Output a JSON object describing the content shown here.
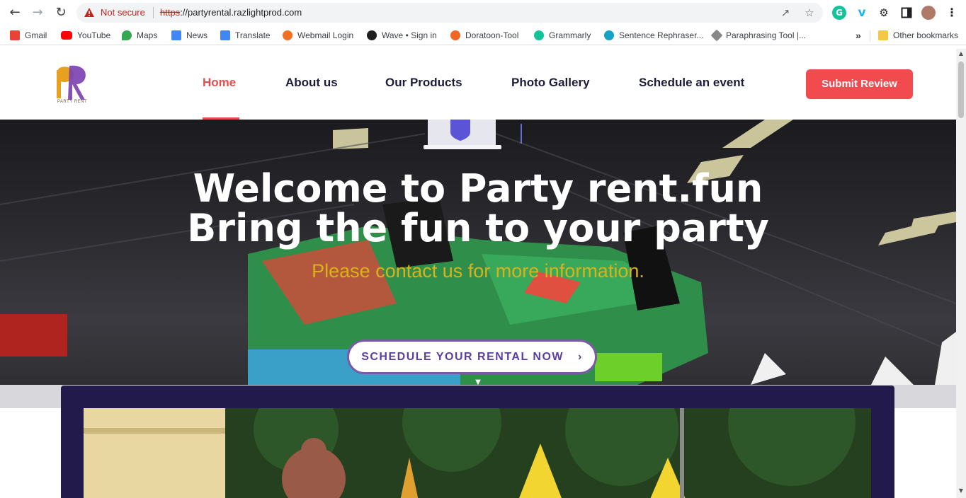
{
  "browser": {
    "not_secure_label": "Not secure",
    "url_scheme": "https",
    "url_rest": "://partyrental.razlightprod.com",
    "bookmarks": [
      {
        "label": "Gmail",
        "icon": "gmail-icon",
        "color": "#ea4335"
      },
      {
        "label": "YouTube",
        "icon": "youtube-icon",
        "color": "#ff0000"
      },
      {
        "label": "Maps",
        "icon": "maps-icon",
        "color": "#34a853"
      },
      {
        "label": "News",
        "icon": "news-icon",
        "color": "#4285f4"
      },
      {
        "label": "Translate",
        "icon": "translate-icon",
        "color": "#4285f4"
      },
      {
        "label": "Webmail Login",
        "icon": "webmail-icon",
        "color": "#f37021"
      },
      {
        "label": "Wave • Sign in",
        "icon": "wave-icon",
        "color": "#1f1f1f"
      },
      {
        "label": "Doratoon-Tool",
        "icon": "doratoon-icon",
        "color": "#f26522"
      },
      {
        "label": "Grammarly",
        "icon": "grammarly-icon",
        "color": "#15c39a"
      },
      {
        "label": "Sentence Rephraser...",
        "icon": "rephraser-icon",
        "color": "#15a3c3"
      },
      {
        "label": "Paraphrasing Tool |...",
        "icon": "paraphrase-icon",
        "color": "#888888"
      }
    ],
    "more_bookmarks": "»",
    "other_bookmarks": "Other bookmarks"
  },
  "site": {
    "logo_text": "PARTY RENT",
    "nav": [
      {
        "label": "Home",
        "active": true
      },
      {
        "label": "About us",
        "active": false
      },
      {
        "label": "Our Products",
        "active": false
      },
      {
        "label": "Photo Gallery",
        "active": false
      },
      {
        "label": "Schedule an event",
        "active": false
      }
    ],
    "submit_review": "Submit Review",
    "accent": "#f14a4f"
  },
  "hero": {
    "title_line1": "Welcome to Party rent.fun",
    "title_line2": "Bring the fun to your party",
    "subtitle": "Please contact us for more information.",
    "cta": "SCHEDULE YOUR RENTAL NOW"
  }
}
